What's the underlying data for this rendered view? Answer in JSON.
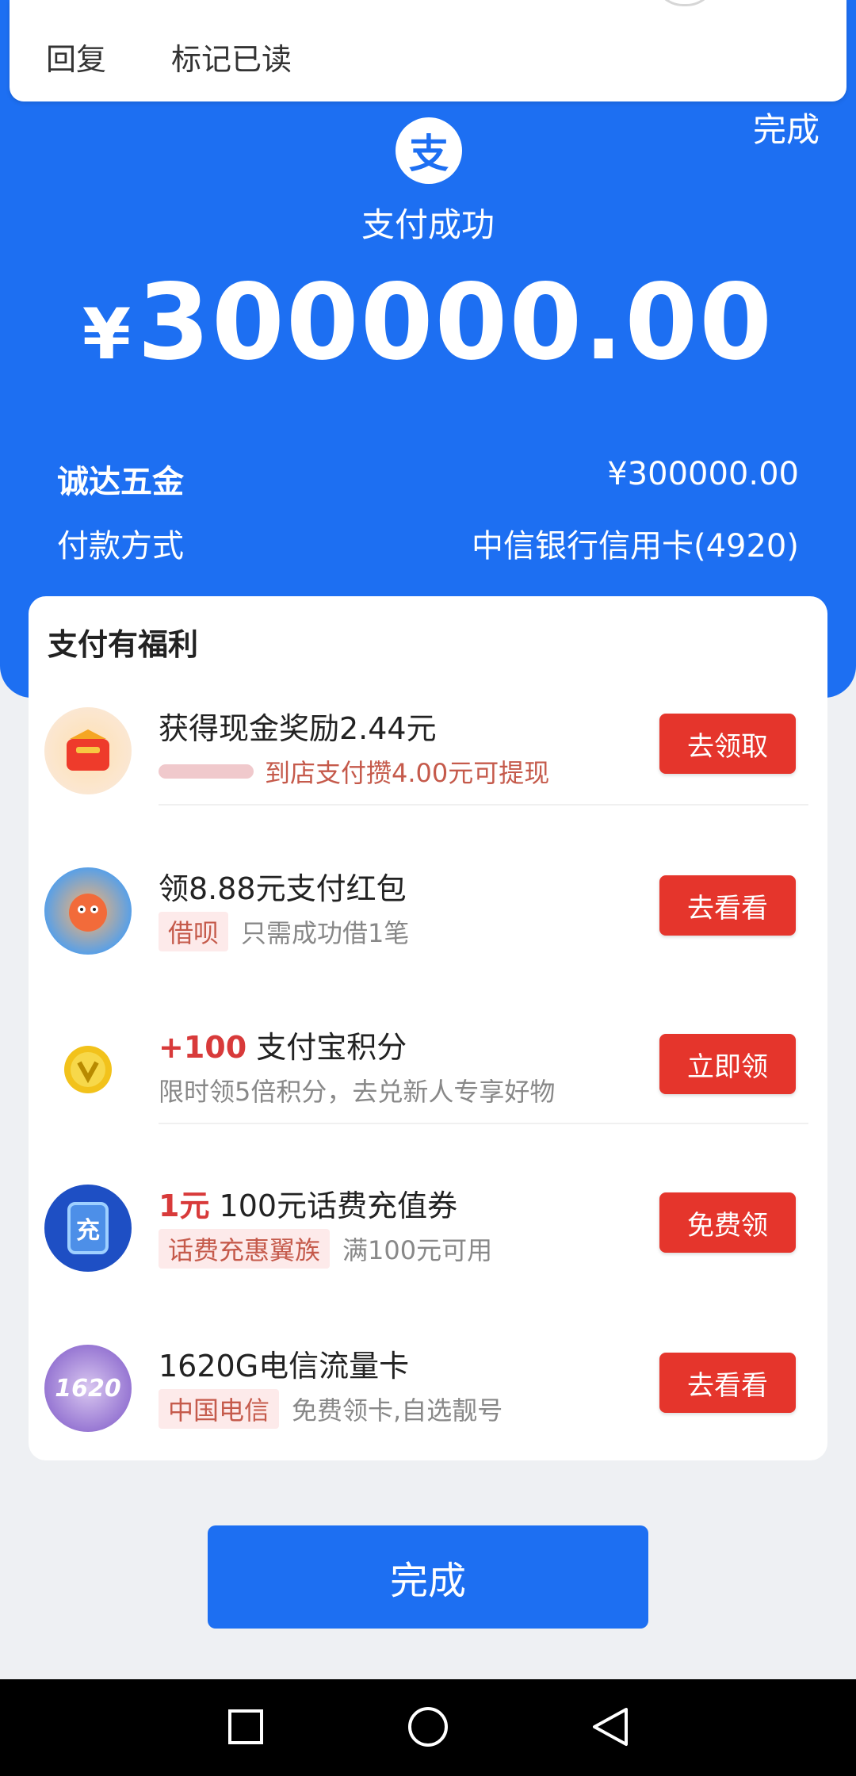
{
  "notification": {
    "reply_label": "回复",
    "mark_read_label": "标记已读"
  },
  "header": {
    "done_label": "完成",
    "logo_glyph": "支",
    "status_text": "支付成功",
    "currency_symbol": "¥",
    "amount": "300000.00"
  },
  "details": {
    "merchant_label": "诚达五金",
    "merchant_amount": "¥300000.00",
    "method_label": "付款方式",
    "method_value": "中信银行信用卡(4920)"
  },
  "benefits": {
    "title": "支付有福利",
    "offers": [
      {
        "icon": "red-envelope-icon",
        "title": "获得现金奖励2.44元",
        "subtitle": "到店支付攒4.00元可提现",
        "button": "去领取"
      },
      {
        "icon": "mascot-icon",
        "title": "领8.88元支付红包",
        "tag": "借呗",
        "subtitle": "只需成功借1笔",
        "button": "去看看"
      },
      {
        "icon": "coin-icon",
        "title_highlight": "+100",
        "title": "支付宝积分",
        "subtitle": "限时领5倍积分，去兑新人专享好物",
        "button": "立即领"
      },
      {
        "icon": "recharge-icon",
        "icon_glyph": "充",
        "title_highlight": "1元",
        "title": "100元话费充值券",
        "tag": "话费充惠翼族",
        "subtitle": "满100元可用",
        "button": "免费领"
      },
      {
        "icon": "sim-card-icon",
        "icon_glyph": "1620",
        "title": "1620G电信流量卡",
        "tag": "中国电信",
        "subtitle": "免费领卡,自选靓号",
        "button": "去看看"
      }
    ]
  },
  "footer": {
    "done_label": "完成"
  },
  "colors": {
    "brand_blue": "#1d6ff2",
    "action_red": "#e5352c"
  }
}
